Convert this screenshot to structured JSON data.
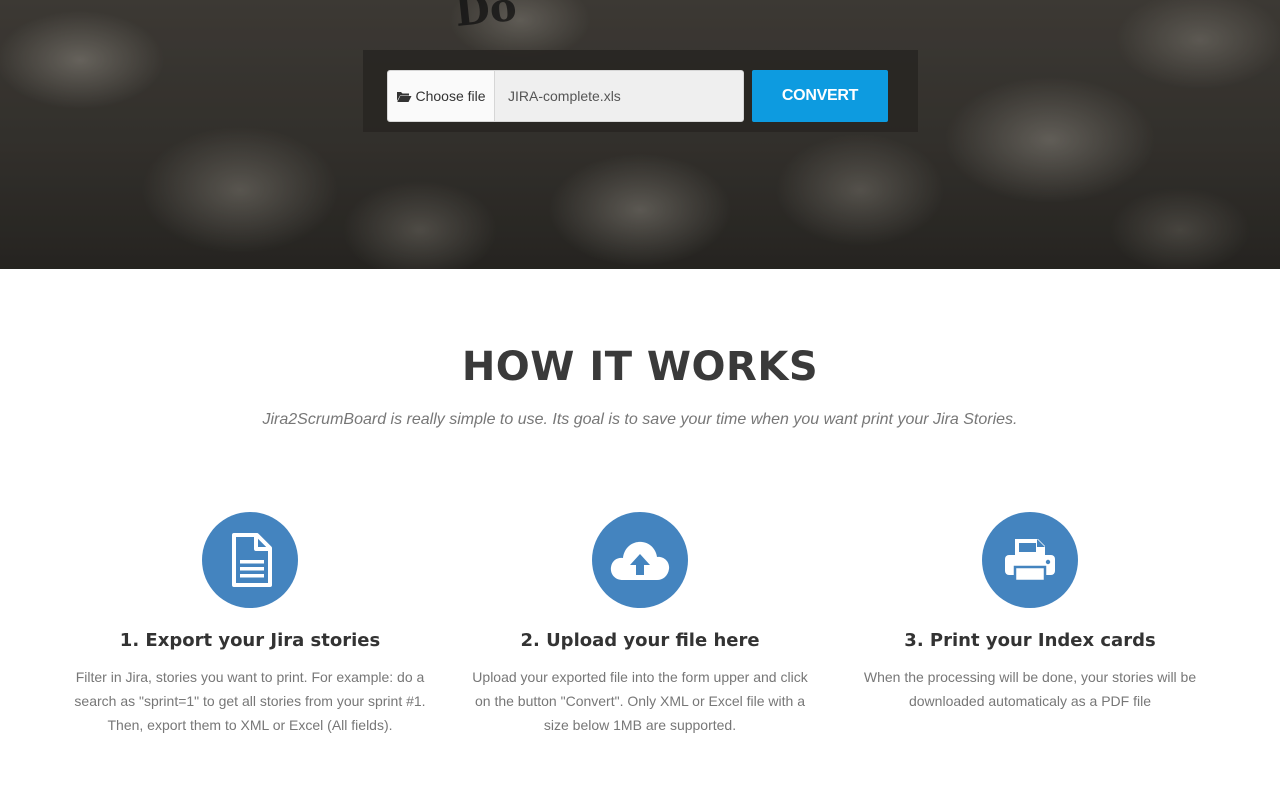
{
  "upload_form": {
    "choose_file_label": "Choose file",
    "file_name": "JIRA-complete.xls",
    "convert_label": "CONVERT"
  },
  "how_it_works": {
    "title": "HOW IT WORKS",
    "subtitle": "Jira2ScrumBoard is really simple to use. Its goal is to save your time when you want print your Jira Stories.",
    "steps": [
      {
        "icon": "document-icon",
        "title": "1. Export your Jira stories",
        "text": "Filter in Jira, stories you want to print. For example: do a search as \"sprint=1\" to get all stories from your sprint #1. Then, export them to XML or Excel (All fields)."
      },
      {
        "icon": "cloud-upload-icon",
        "title": "2. Upload your file here",
        "text": "Upload your exported file into the form upper and click on the button \"Convert\". Only XML or Excel file with a size below 1MB are supported."
      },
      {
        "icon": "printer-icon",
        "title": "3. Print your Index cards",
        "text": "When the processing will be done, your stories will be downloaded automaticaly as a PDF file"
      }
    ]
  },
  "colors": {
    "accent": "#0d9be0",
    "step_circle": "#4484bf"
  }
}
